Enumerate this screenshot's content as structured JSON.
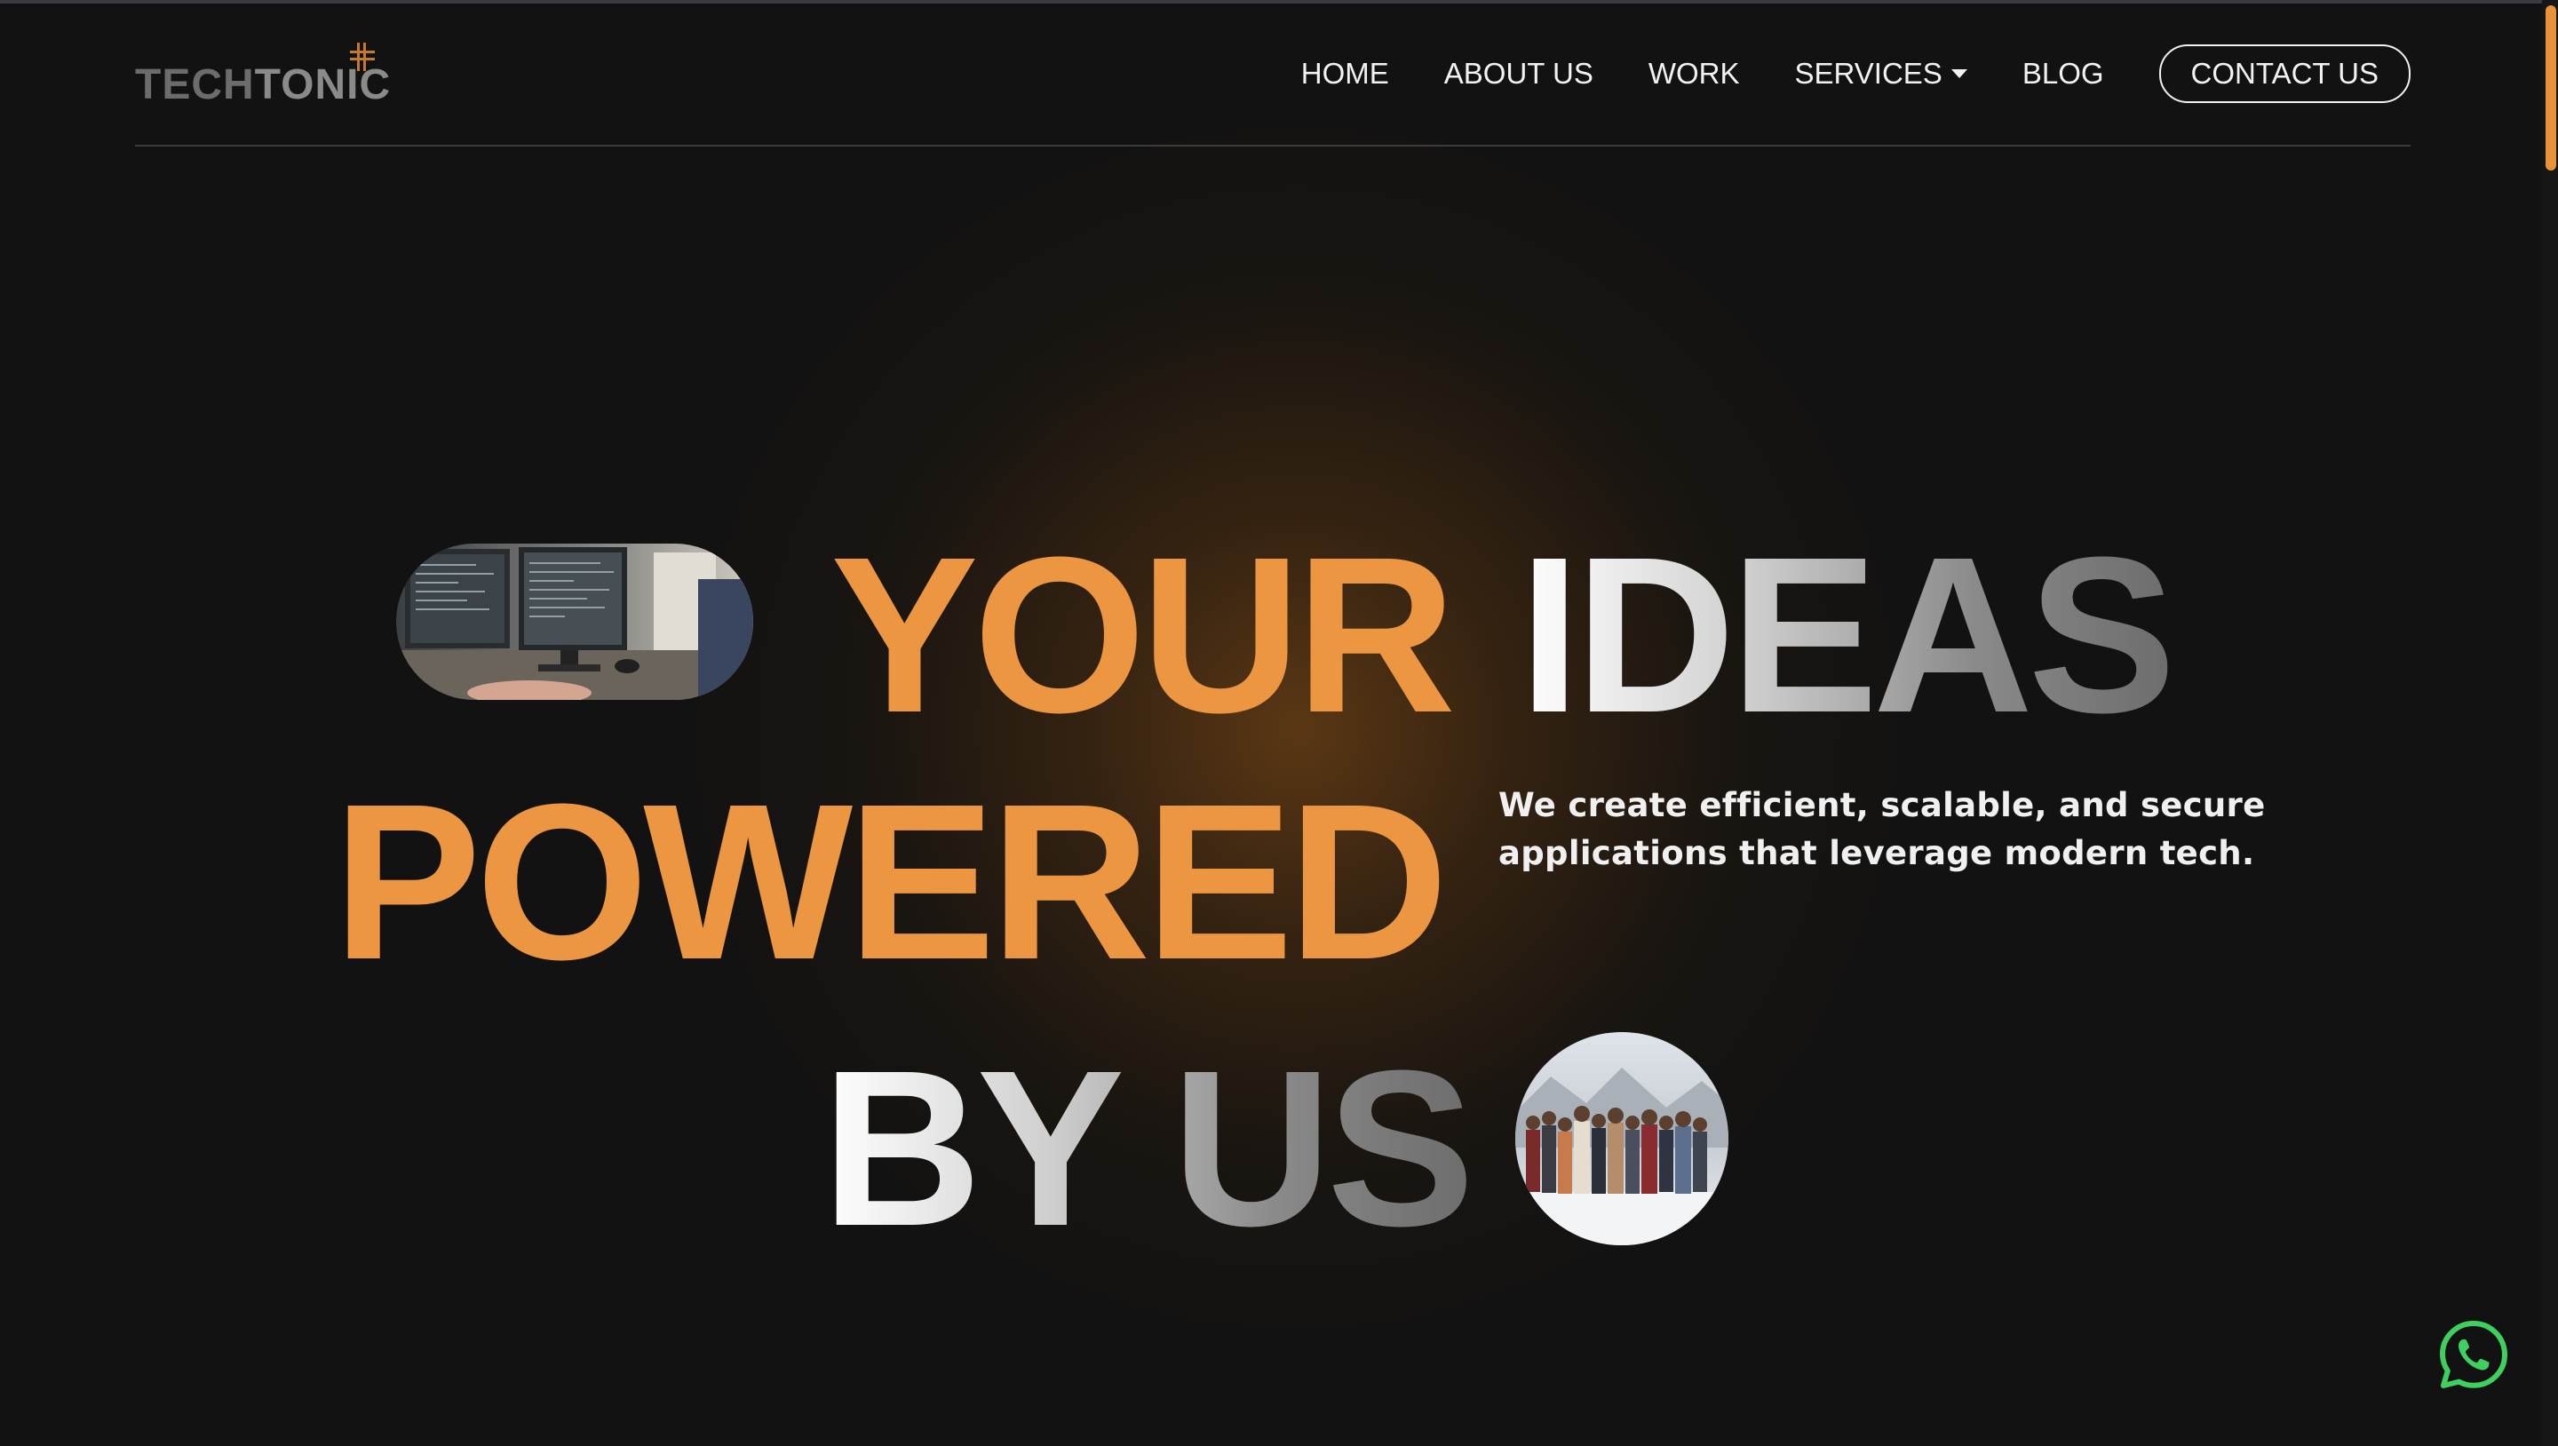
{
  "brand": {
    "logo_part1": "TECH",
    "logo_part2": "TONIC",
    "icon": "circuit-cross-icon",
    "accent_color": "#ec9641"
  },
  "nav": {
    "items": [
      {
        "label": "HOME"
      },
      {
        "label": "ABOUT US"
      },
      {
        "label": "WORK"
      },
      {
        "label": "SERVICES"
      },
      {
        "label": "BLOG"
      }
    ],
    "services_icon": "caret-down-icon",
    "contact_label": "CONTACT US"
  },
  "hero": {
    "line1_orange": "YOUR",
    "line1_silver": "IDEAS",
    "line2_orange": "POWERED",
    "line3_silver": "BY US",
    "tagline": "We create efficient, scalable, and secure applications that leverage modern tech.",
    "pill_image": "office-workstation-photo",
    "circle_image": "team-group-snow-photo"
  },
  "floating": {
    "whatsapp_icon": "whatsapp-icon",
    "whatsapp_color": "#3fcf5f"
  },
  "colors": {
    "background": "#121212",
    "text": "#f2f2f2",
    "scroll_thumb": "#e8923a"
  }
}
